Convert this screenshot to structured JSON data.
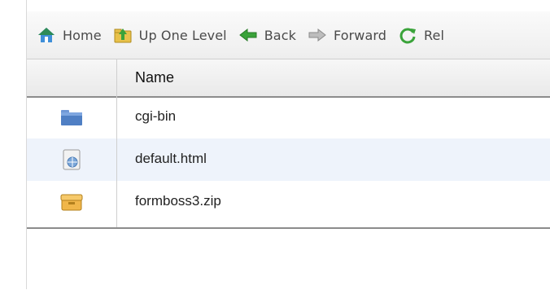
{
  "toolbar": {
    "items": [
      {
        "label": "Home",
        "icon": "home-icon"
      },
      {
        "label": "Up One Level",
        "icon": "up-folder-icon"
      },
      {
        "label": "Back",
        "icon": "back-arrow-icon"
      },
      {
        "label": "Forward",
        "icon": "forward-arrow-icon"
      },
      {
        "label": "Rel",
        "icon": "reload-icon"
      }
    ]
  },
  "grid": {
    "header": {
      "name": "Name"
    },
    "rows": [
      {
        "name": "cgi-bin",
        "icon": "folder-icon"
      },
      {
        "name": "default.html",
        "icon": "html-file-icon"
      },
      {
        "name": "formboss3.zip",
        "icon": "zip-archive-icon"
      }
    ]
  },
  "colors": {
    "row_alt": "#eef3fb",
    "folder": "#4f7fc4",
    "home_roof": "#2e8b57",
    "arrow_green": "#3aa33a"
  }
}
